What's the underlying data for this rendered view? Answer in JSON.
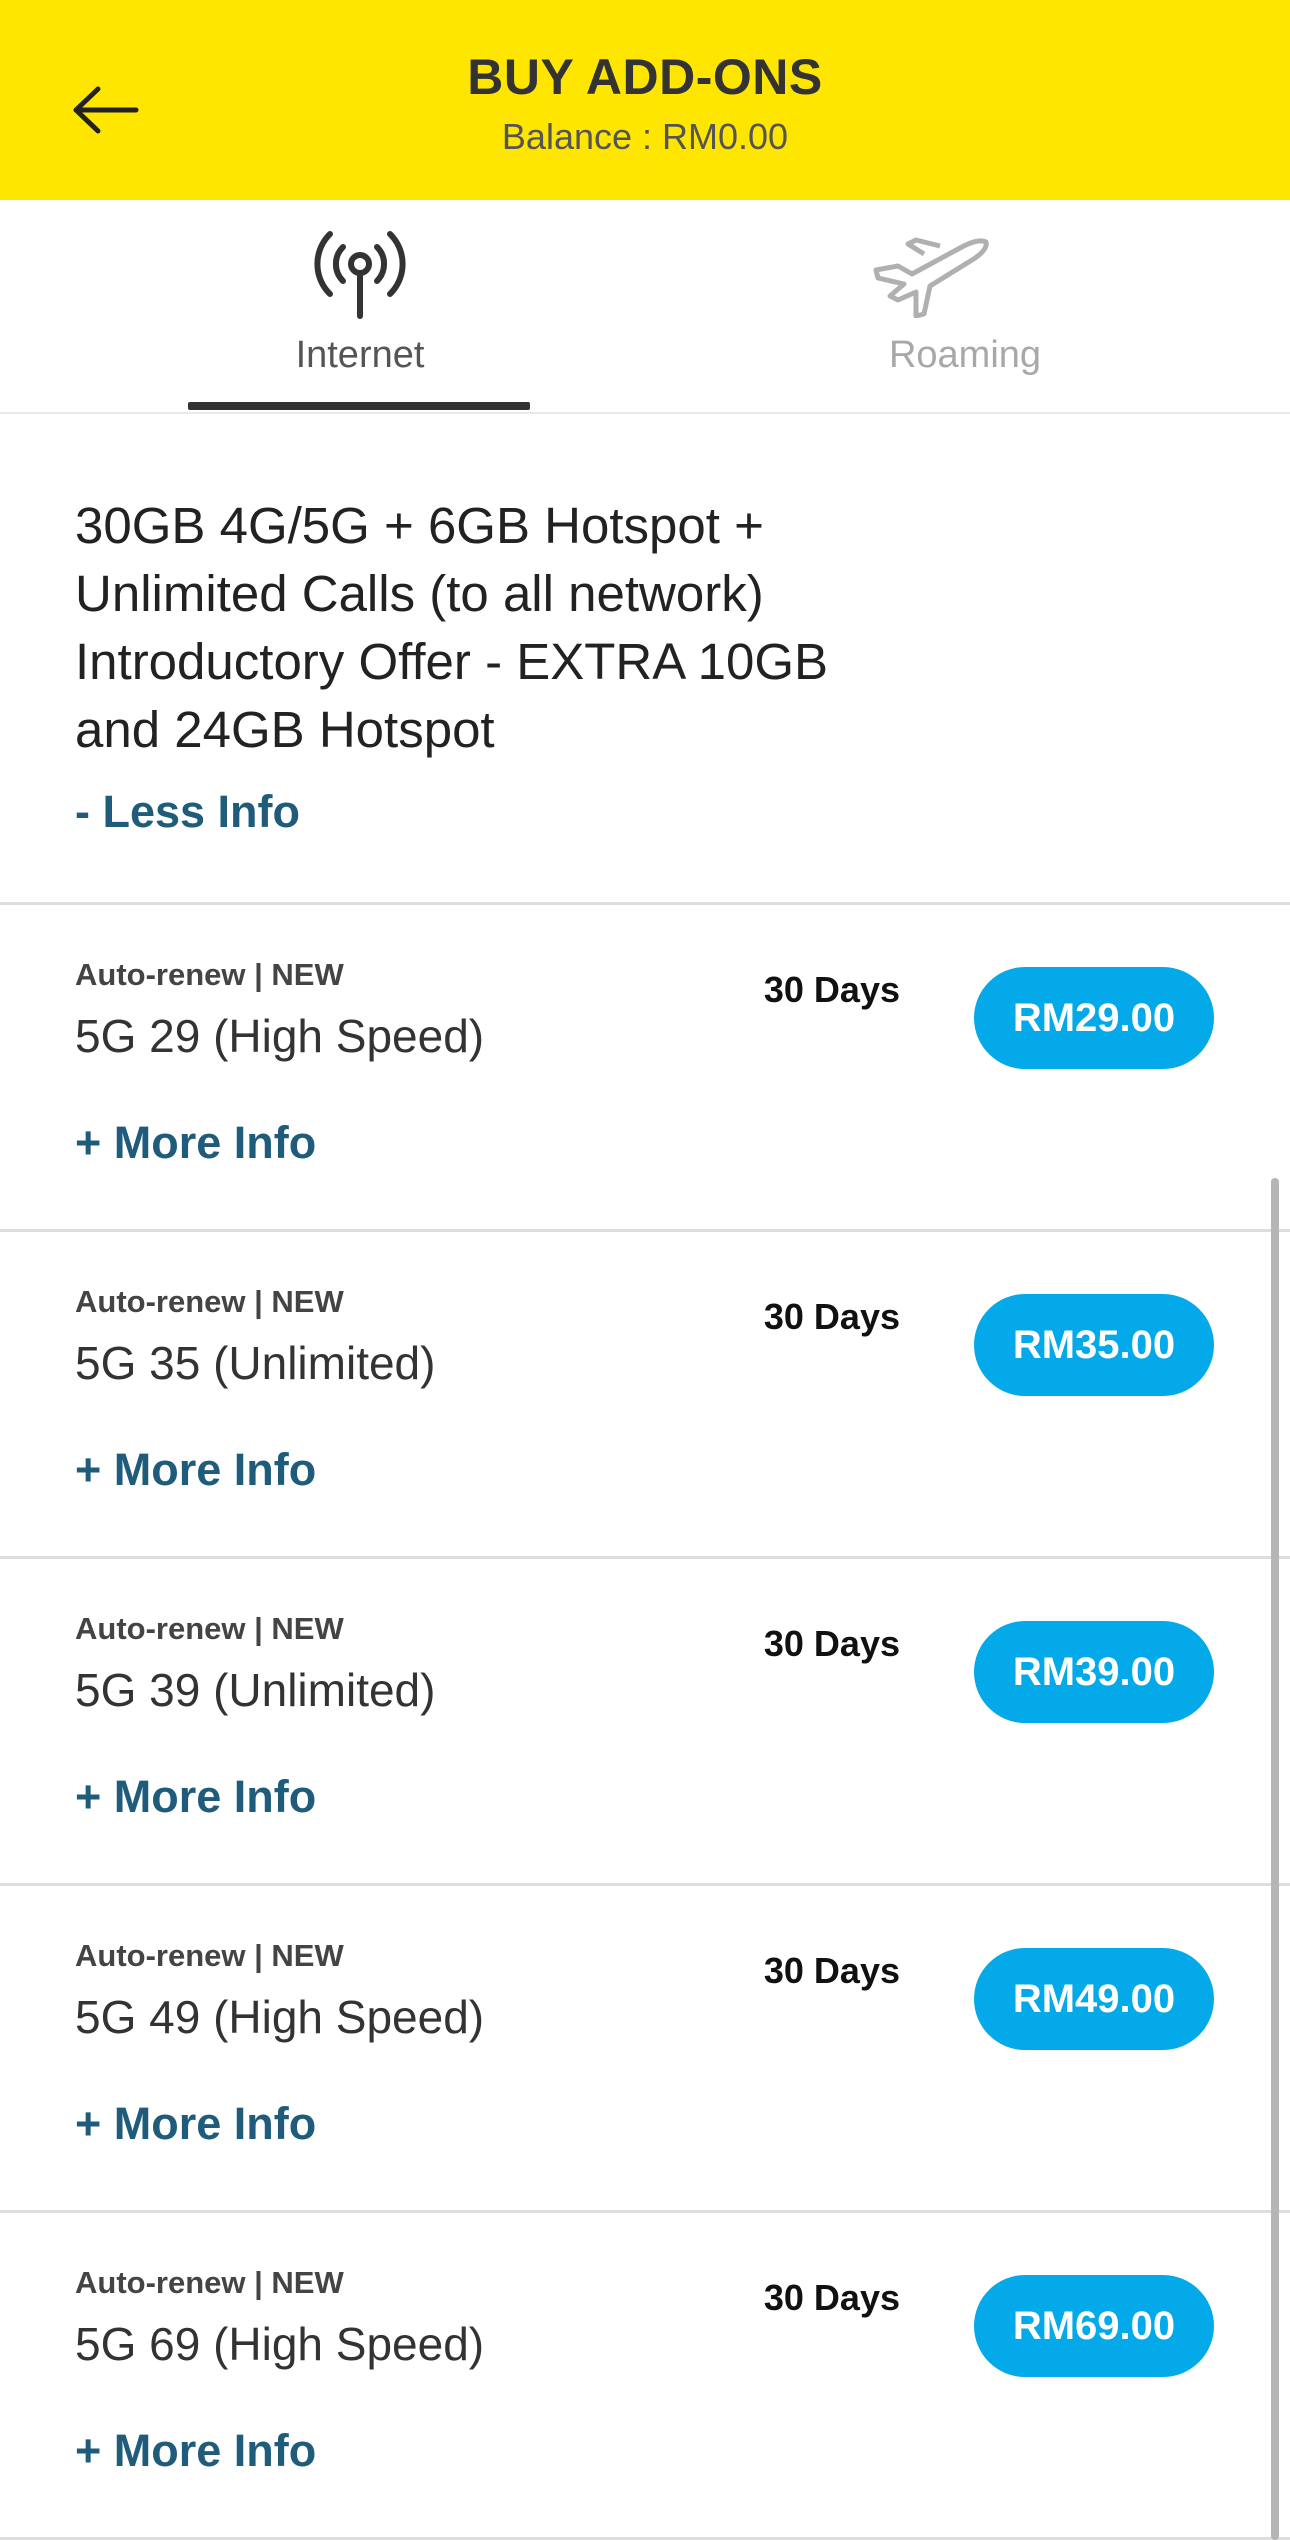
{
  "header": {
    "title": "BUY ADD-ONS",
    "balance": "Balance : RM0.00",
    "back_icon": "arrow-left-icon",
    "background": "#ffe600"
  },
  "tabs": [
    {
      "label": "Internet",
      "icon": "antenna-signal-icon",
      "active": true
    },
    {
      "label": "Roaming",
      "icon": "airplane-icon",
      "active": false
    }
  ],
  "intro": {
    "lines": [
      "30GB 4G/5G + 6GB Hotspot +",
      "Unlimited Calls (to all network)",
      "Introductory Offer - EXTRA 10GB",
      "and 24GB Hotspot"
    ],
    "toggle_label": "- Less Info"
  },
  "plans": [
    {
      "tag": "Auto-renew | NEW",
      "name": "5G 29 (High Speed)",
      "validity": "30 Days",
      "price": "RM29.00",
      "more_label": "+ More Info"
    },
    {
      "tag": "Auto-renew | NEW",
      "name": "5G 35 (Unlimited)",
      "validity": "30 Days",
      "price": "RM35.00",
      "more_label": "+ More Info"
    },
    {
      "tag": "Auto-renew | NEW",
      "name": "5G 39 (Unlimited)",
      "validity": "30 Days",
      "price": "RM39.00",
      "more_label": "+ More Info"
    },
    {
      "tag": "Auto-renew | NEW",
      "name": "5G 49 (High Speed)",
      "validity": "30 Days",
      "price": "RM49.00",
      "more_label": "+ More Info"
    },
    {
      "tag": "Auto-renew | NEW",
      "name": "5G 69 (High Speed)",
      "validity": "30 Days",
      "price": "RM69.00",
      "more_label": "+ More Info"
    }
  ],
  "colors": {
    "accent_yellow": "#ffe600",
    "price_button": "#03a9e8",
    "info_link": "#1f5b7a"
  }
}
